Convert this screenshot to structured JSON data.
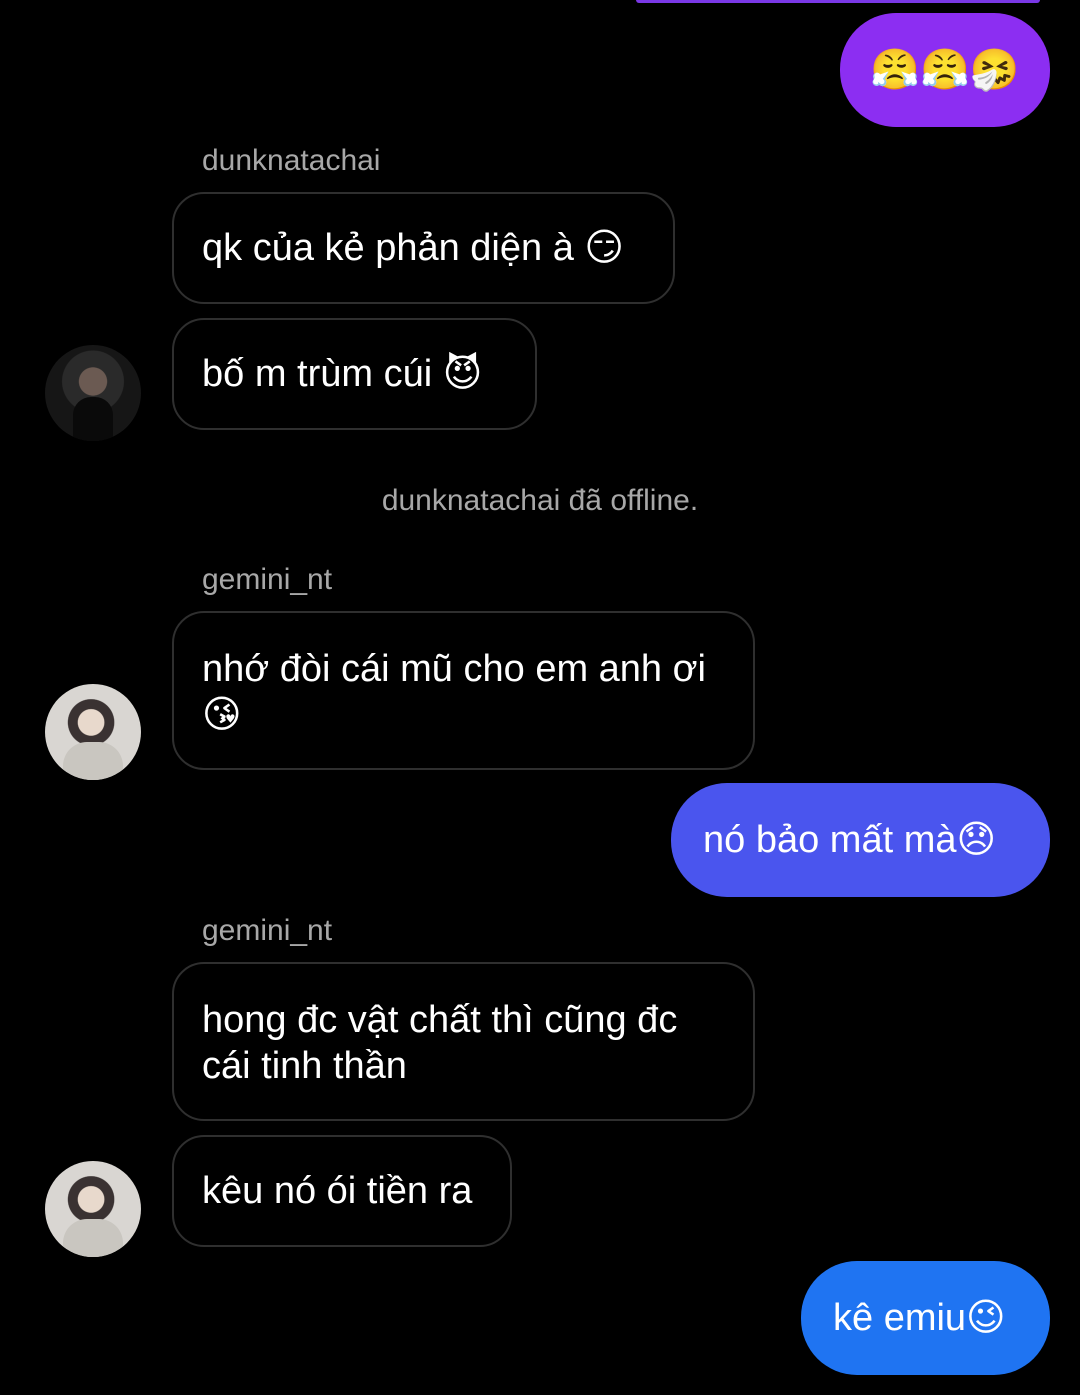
{
  "colors": {
    "background": "#000000",
    "incoming_border": "#2f2f2f",
    "outgoing_purple": "#8c2ef2",
    "outgoing_blue_violet": "#4a55ee",
    "outgoing_blue": "#1f74f2",
    "muted_text": "#a8a8a8"
  },
  "messages": [
    {
      "direction": "outgoing",
      "text": "😤😤🤧",
      "color": "#8c2ef2"
    },
    {
      "direction": "incoming",
      "sender": "dunknatachai",
      "text": "qk của kẻ phản diện à 😏"
    },
    {
      "direction": "incoming",
      "text": "bố m trùm cúi 😈",
      "avatar": "dunknatachai-avatar"
    },
    {
      "type": "system",
      "text": "dunknatachai đã offline."
    },
    {
      "direction": "incoming",
      "sender": "gemini_nt",
      "text": "nhớ đòi cái mũ cho em anh ơi 😘",
      "avatar": "gemini-nt-avatar"
    },
    {
      "direction": "outgoing",
      "text": "nó bảo mất mà😞",
      "color": "#4a55ee"
    },
    {
      "direction": "incoming",
      "sender": "gemini_nt",
      "text": "hong đc vật chất thì cũng đc cái tinh thần"
    },
    {
      "direction": "incoming",
      "text": "kêu nó ói tiền ra",
      "avatar": "gemini-nt-avatar"
    },
    {
      "direction": "outgoing",
      "text": "kê emiu😉",
      "color": "#1f74f2"
    }
  ]
}
